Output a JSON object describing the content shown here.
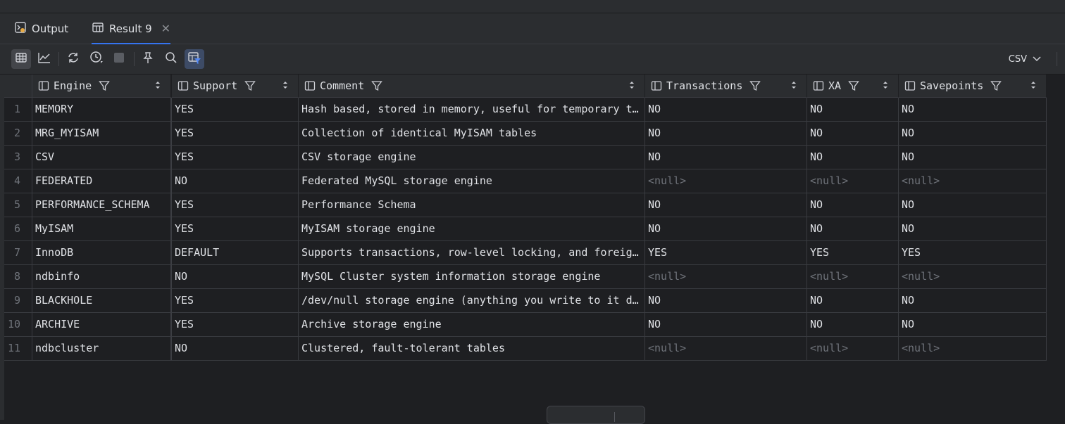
{
  "tabs": [
    {
      "label": "Output",
      "icon": "output-icon",
      "active": false
    },
    {
      "label": "Result 9",
      "icon": "table-icon",
      "active": true,
      "closable": true
    }
  ],
  "toolbar": {
    "buttons": [
      "table-view-icon",
      "chart-view-icon",
      "refresh-icon",
      "history-icon",
      "stop-icon",
      "pin-icon",
      "search-icon",
      "filter-toggle-icon"
    ],
    "export_format": "CSV"
  },
  "columns": [
    "Engine",
    "Support",
    "Comment",
    "Transactions",
    "XA",
    "Savepoints"
  ],
  "rows": [
    {
      "n": "1",
      "engine": "MEMORY",
      "support": "YES",
      "comment": "Hash based, stored in memory, useful for temporary tables",
      "transactions": "NO",
      "xa": "NO",
      "savepoints": "NO"
    },
    {
      "n": "2",
      "engine": "MRG_MYISAM",
      "support": "YES",
      "comment": "Collection of identical MyISAM tables",
      "transactions": "NO",
      "xa": "NO",
      "savepoints": "NO"
    },
    {
      "n": "3",
      "engine": "CSV",
      "support": "YES",
      "comment": "CSV storage engine",
      "transactions": "NO",
      "xa": "NO",
      "savepoints": "NO"
    },
    {
      "n": "4",
      "engine": "FEDERATED",
      "support": "NO",
      "comment": "Federated MySQL storage engine",
      "transactions": "<null>",
      "xa": "<null>",
      "savepoints": "<null>"
    },
    {
      "n": "5",
      "engine": "PERFORMANCE_SCHEMA",
      "support": "YES",
      "comment": "Performance Schema",
      "transactions": "NO",
      "xa": "NO",
      "savepoints": "NO"
    },
    {
      "n": "6",
      "engine": "MyISAM",
      "support": "YES",
      "comment": "MyISAM storage engine",
      "transactions": "NO",
      "xa": "NO",
      "savepoints": "NO"
    },
    {
      "n": "7",
      "engine": "InnoDB",
      "support": "DEFAULT",
      "comment": "Supports transactions, row-level locking, and foreign keys",
      "transactions": "YES",
      "xa": "YES",
      "savepoints": "YES"
    },
    {
      "n": "8",
      "engine": "ndbinfo",
      "support": "NO",
      "comment": "MySQL Cluster system information storage engine",
      "transactions": "<null>",
      "xa": "<null>",
      "savepoints": "<null>"
    },
    {
      "n": "9",
      "engine": "BLACKHOLE",
      "support": "YES",
      "comment": "/dev/null storage engine (anything you write to it disappears)",
      "transactions": "NO",
      "xa": "NO",
      "savepoints": "NO"
    },
    {
      "n": "10",
      "engine": "ARCHIVE",
      "support": "YES",
      "comment": "Archive storage engine",
      "transactions": "NO",
      "xa": "NO",
      "savepoints": "NO"
    },
    {
      "n": "11",
      "engine": "ndbcluster",
      "support": "NO",
      "comment": "Clustered, fault-tolerant tables",
      "transactions": "<null>",
      "xa": "<null>",
      "savepoints": "<null>"
    }
  ]
}
